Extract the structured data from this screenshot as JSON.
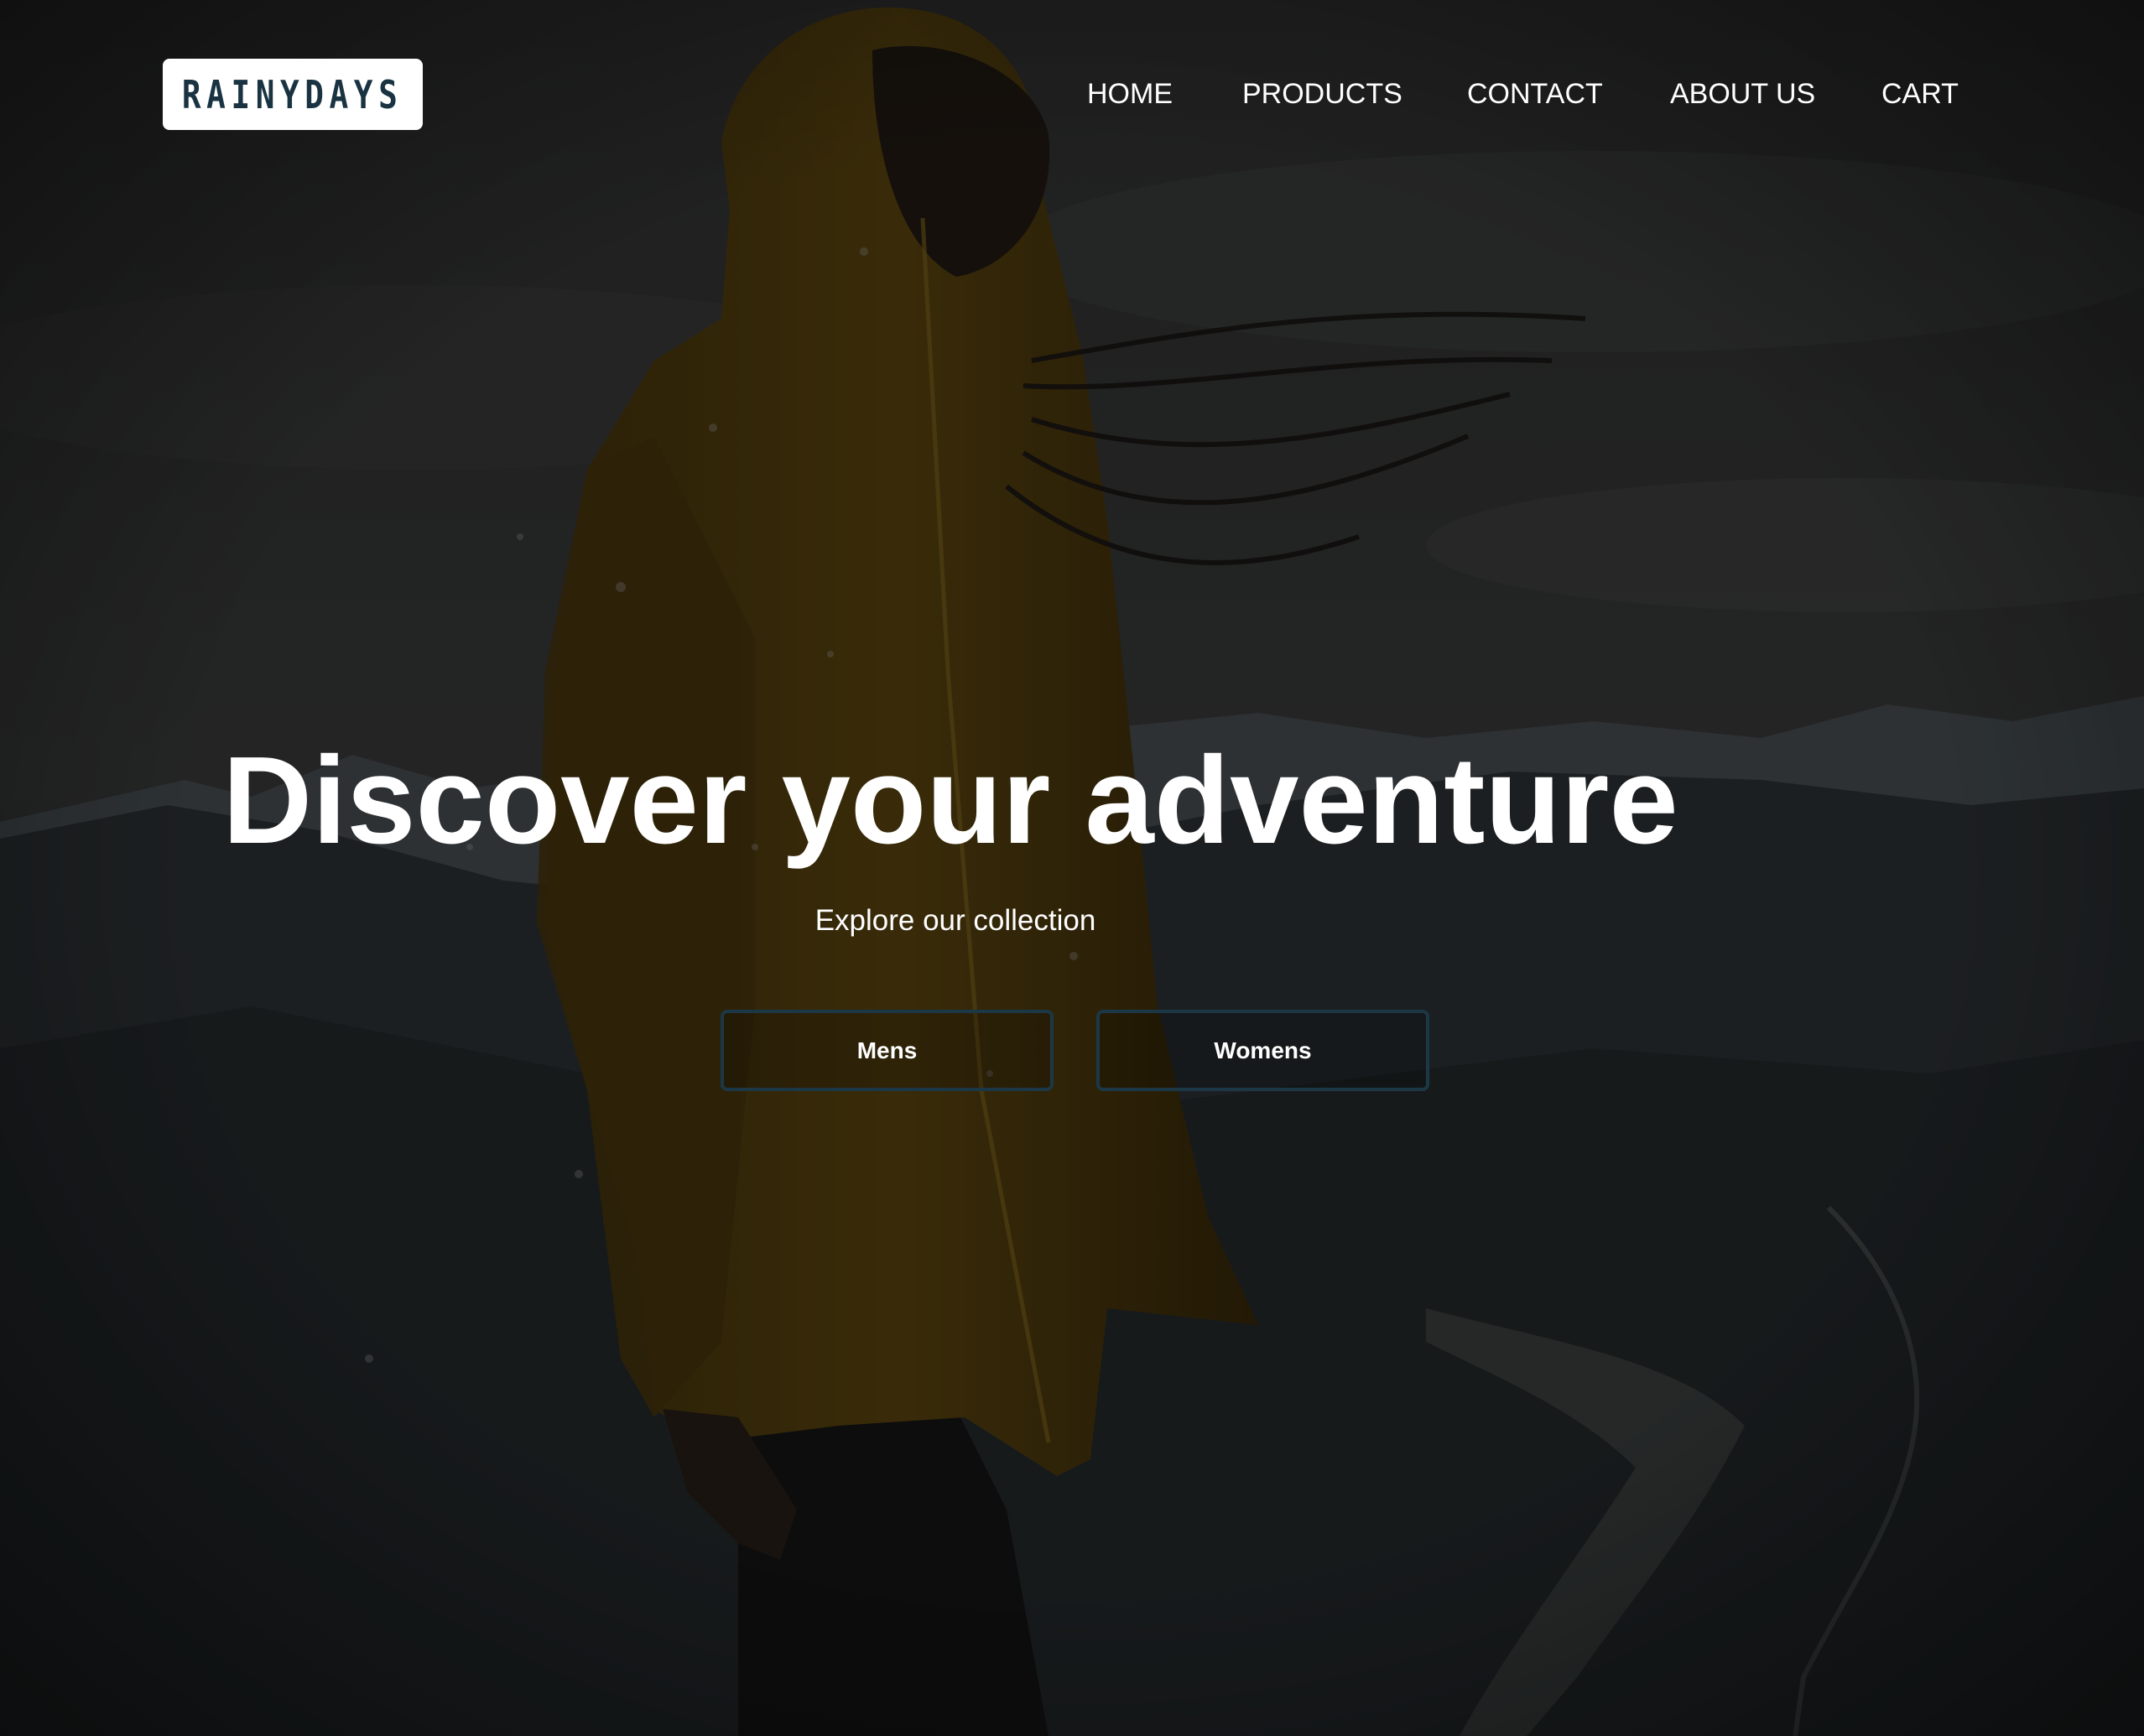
{
  "header": {
    "logo_text": "RAINYDAYS",
    "nav": [
      {
        "label": "HOME"
      },
      {
        "label": "PRODUCTS"
      },
      {
        "label": "CONTACT"
      },
      {
        "label": "ABOUT US"
      },
      {
        "label": "CART"
      }
    ]
  },
  "hero": {
    "title": "Discover your adventure",
    "subtitle": "Explore our collection",
    "buttons": [
      {
        "label": "Mens"
      },
      {
        "label": "Womens"
      }
    ]
  },
  "colors": {
    "brand_dark": "#1a3342",
    "button_border": "#1c3846",
    "jacket": "#5a4310"
  }
}
